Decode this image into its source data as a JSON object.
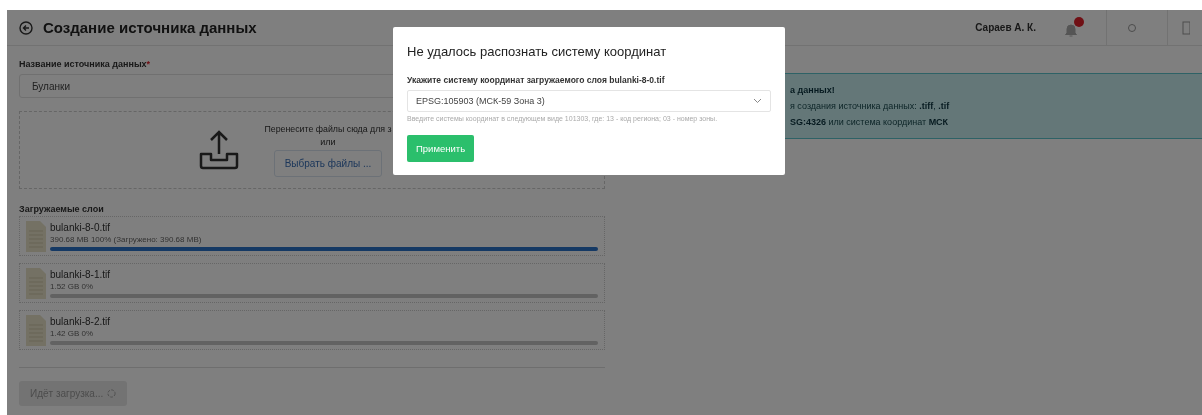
{
  "header": {
    "title": "Создание источника данных",
    "user": "Сараев А. К."
  },
  "name_field": {
    "label": "Название источника данных",
    "required_mark": "*",
    "value": "Буланки"
  },
  "dropzone": {
    "text": "Перенесите файлы сюда для з",
    "or": "или",
    "button": "Выбрать файлы ..."
  },
  "info": {
    "lines": [
      "**а данных!**",
      "я создания источника данных: **.tiff**, **.tif**",
      "**SG:4326** или система координат **МСК**"
    ]
  },
  "layers": {
    "title": "Загружаемые слои",
    "items": [
      {
        "name": "bulanki-8-0.tif",
        "meta": "390.68 MB 100% (Загружено: 390.68 MB)",
        "level": 1
      },
      {
        "name": "bulanki-8-1.tif",
        "meta": "1.52 GB 0%",
        "level": 0
      },
      {
        "name": "bulanki-8-2.tif",
        "meta": "1.42 GB 0%",
        "level": 0
      }
    ]
  },
  "submit": {
    "label": "Идёт загрузка...",
    "disabled": true
  },
  "dialog": {
    "title": "Не удалось распознать систему координат",
    "label": "Укажите систему координат загружаемого слоя bulanki-8-0.tif",
    "value": "EPSG:105903 (МСК-59 Зона 3)",
    "hint": "Введите системы координат в следующем виде 101303, где: 13 - код региона; 03 - номер зоны.",
    "button": "Применить"
  }
}
